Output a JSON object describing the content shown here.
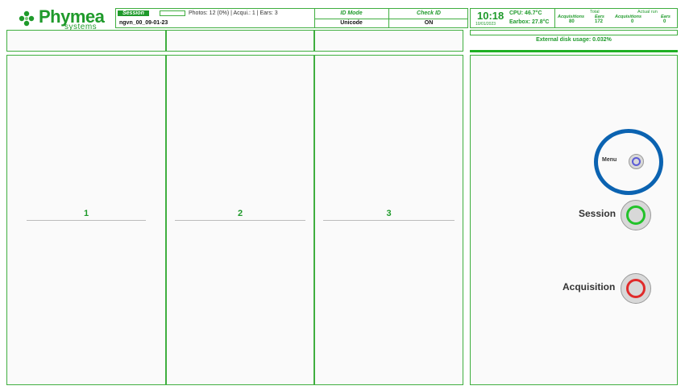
{
  "logo": {
    "brand": "Phymea",
    "tagline": "systems"
  },
  "header": {
    "session_tag": "Session",
    "session_name": "ngvn_00_09-01-23",
    "stats": "Photos: 12 (0%) | Acqui.: 1 | Ears: 3",
    "id_mode_label": "ID Mode",
    "id_mode_value": "Unicode",
    "check_id_label": "Check ID",
    "check_id_value": "ON"
  },
  "status": {
    "time": "10:18",
    "date": "10/01/2023",
    "cpu": "CPU: 46.7°C",
    "earbox": "Earbox: 27.8°C",
    "total_label": "Total",
    "actual_run_label": "Actual run",
    "acquisitions_label": "Acquisitions",
    "ears_label": "Ears",
    "total_acquisitions": "80",
    "total_ears": "172",
    "run_acquisitions": "0",
    "run_ears": "0",
    "disk_usage": "External disk usage: 0.032%"
  },
  "panels": [
    {
      "label": "1"
    },
    {
      "label": "2"
    },
    {
      "label": "3"
    }
  ],
  "controls": {
    "menu_label": "Menu",
    "session_label": "Session",
    "acquisition_label": "Acquisition"
  },
  "colors": {
    "accent": "#1f9a2b",
    "border": "#3fae3f",
    "menu_ring": "#5b5bd6",
    "session_ring": "#22c22a",
    "acquisition_ring": "#e02b2b",
    "highlight": "#0b63b1"
  }
}
